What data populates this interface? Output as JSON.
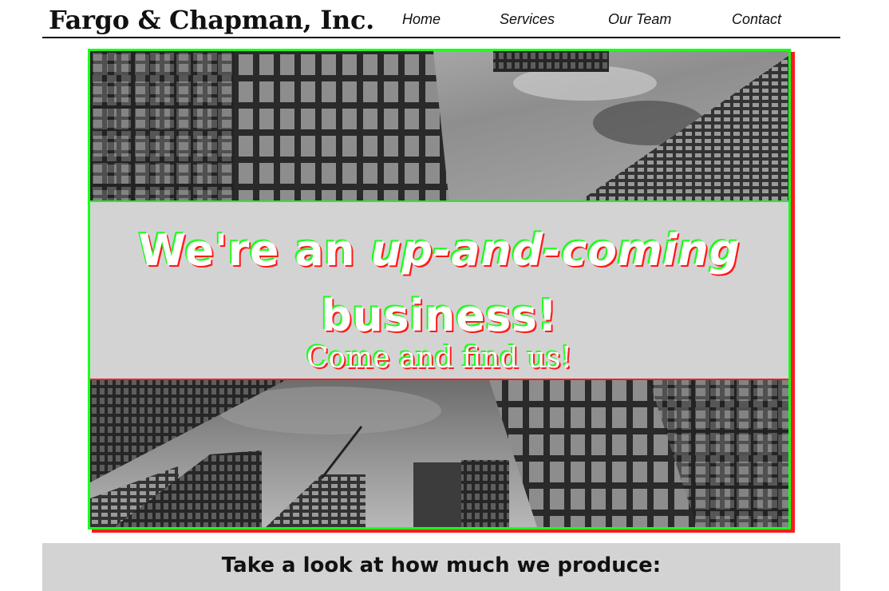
{
  "header": {
    "brand": "Fargo & Chapman, Inc.",
    "nav": [
      {
        "label": "Home"
      },
      {
        "label": "Services"
      },
      {
        "label": "Our Team"
      },
      {
        "label": "Contact"
      }
    ]
  },
  "hero": {
    "headline_lead": "We're an ",
    "headline_emphasis": "up-and-coming",
    "headline_tail": " business!",
    "subline": "Come and find us!",
    "photo": "black-and-white skyscrapers viewed from below"
  },
  "production": {
    "heading": "Take a look at how much we produce:"
  },
  "colors": {
    "frame_green": "#1aff1a",
    "frame_red": "#ff1a1a",
    "band_gray": "#d3d3d3"
  }
}
